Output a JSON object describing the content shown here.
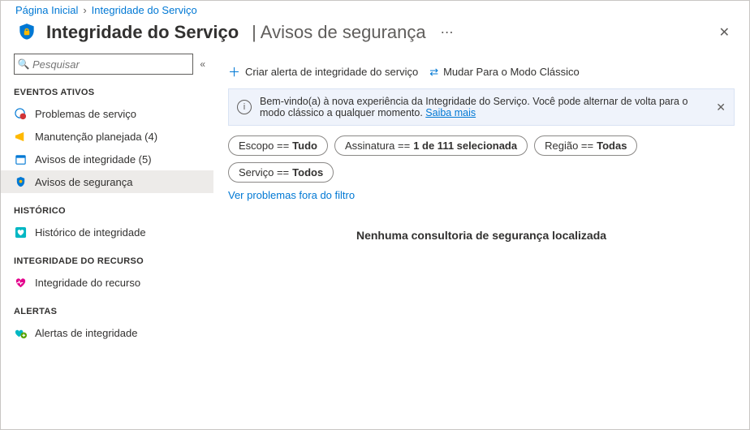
{
  "breadcrumb": {
    "home": "Página Inicial",
    "current": "Integridade do Serviço"
  },
  "header": {
    "title": "Integridade do Serviço",
    "subtitle": "Avisos de segurança"
  },
  "search": {
    "placeholder": "Pesquisar"
  },
  "sidebar": {
    "sections": {
      "eventos": "EVENTOS ATIVOS",
      "historico": "HISTÓRICO",
      "integridade": "INTEGRIDADE DO RECURSO",
      "alertas": "ALERTAS"
    },
    "items": {
      "problemas": "Problemas de serviço",
      "manutencao": "Manutenção planejada (4)",
      "avisos_int": "Avisos de integridade (5)",
      "avisos_seg": "Avisos de segurança",
      "historico_int": "Histórico de integridade",
      "integridade_rec": "Integridade do recurso",
      "alertas_int": "Alertas de integridade"
    }
  },
  "toolbar": {
    "create_alert": "Criar alerta de integridade do serviço",
    "classic_mode": "Mudar Para o Modo Clássico"
  },
  "banner": {
    "text_a": "Bem-vindo(a) à nova experiência da Integridade do Serviço. Você pode alternar de volta para o modo clássico a qualquer momento. ",
    "link": "Saiba mais"
  },
  "filters": {
    "escopo_label": "Escopo == ",
    "escopo_value": "Tudo",
    "assinatura_label": "Assinatura == ",
    "assinatura_value": "1 de 111 selecionada",
    "regiao_label": "Região == ",
    "regiao_value": "Todas",
    "servico_label": "Serviço == ",
    "servico_value": "Todos"
  },
  "link_out": "Ver problemas fora do filtro",
  "empty": "Nenhuma consultoria de segurança localizada"
}
